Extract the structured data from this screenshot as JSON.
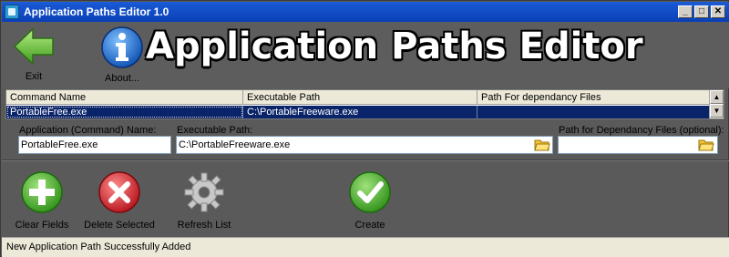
{
  "window": {
    "title": "Application Paths Editor 1.0",
    "controls": [
      "_",
      "□",
      "✕"
    ]
  },
  "toolbar": {
    "exit_label": "Exit",
    "about_label": "About...",
    "big_title": "Application Paths Editor"
  },
  "grid": {
    "columns": [
      "Command Name",
      "Executable Path",
      "Path For dependancy Files"
    ],
    "rows": [
      [
        "PortableFree.exe",
        "C:\\PortableFreeware.exe",
        ""
      ]
    ]
  },
  "form": {
    "command_label": "Application (Command) Name:",
    "command_value": "PortableFree.exe",
    "exe_label": "Executable Path:",
    "exe_value": "C:\\PortableFreeware.exe",
    "dep_label": "Path for Dependancy Files (optional):",
    "dep_value": ""
  },
  "actions": {
    "clear_label": "Clear Fields",
    "delete_label": "Delete Selected",
    "refresh_label": "Refresh List",
    "create_label": "Create"
  },
  "status": {
    "text": "New Application Path Successfully Added"
  },
  "colors": {
    "titlebar": "#0a3fb6",
    "toolbar_bg": "#5d5d5d",
    "selection": "#0a246a",
    "add_green": "#3fae2a",
    "delete_red": "#c8161d"
  }
}
